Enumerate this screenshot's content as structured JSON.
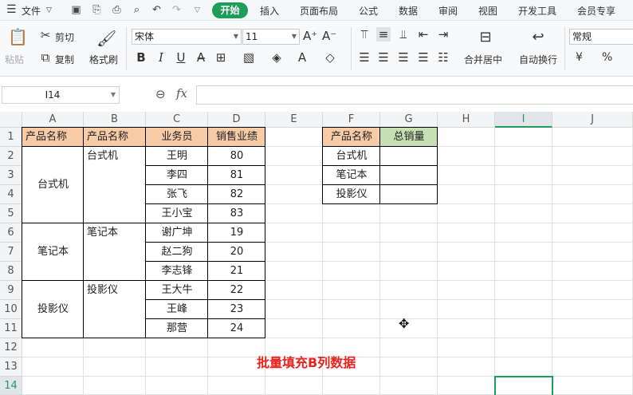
{
  "menubar": {
    "file": "文件",
    "tabs": [
      "开始",
      "插入",
      "页面布局",
      "公式",
      "数据",
      "审阅",
      "视图",
      "开发工具",
      "会员专享"
    ]
  },
  "ribbon": {
    "paste": "粘贴",
    "cut": "剪切",
    "copy": "复制",
    "format_painter": "格式刷",
    "font_name": "宋体",
    "font_size": "11",
    "merge_center": "合并居中",
    "wrap_text": "自动换行",
    "number_format": "常规",
    "currency": "¥",
    "percent": "%"
  },
  "formula_bar": {
    "name_box": "I14",
    "fx": "fx",
    "content": ""
  },
  "columns": [
    "A",
    "B",
    "C",
    "D",
    "E",
    "F",
    "G",
    "H",
    "I",
    "J"
  ],
  "rows": [
    "1",
    "2",
    "3",
    "4",
    "5",
    "6",
    "7",
    "8",
    "9",
    "10",
    "11",
    "12",
    "13",
    "14"
  ],
  "headers": {
    "a1": "产品名称",
    "b1": "产品名称",
    "c1": "业务员",
    "d1": "销售业绩",
    "f1": "产品名称",
    "g1": "总销量"
  },
  "groups": [
    {
      "name": "台式机",
      "b": "台式机",
      "rows": [
        [
          "王明",
          "80"
        ],
        [
          "李四",
          "81"
        ],
        [
          "张飞",
          "82"
        ],
        [
          "王小宝",
          "83"
        ]
      ]
    },
    {
      "name": "笔记本",
      "b": "笔记本",
      "rows": [
        [
          "谢广坤",
          "19"
        ],
        [
          "赵二狗",
          "20"
        ],
        [
          "李志锋",
          "21"
        ]
      ]
    },
    {
      "name": "投影仪",
      "b": "投影仪",
      "rows": [
        [
          "王大牛",
          "22"
        ],
        [
          "王峰",
          "23"
        ],
        [
          "那营",
          "24"
        ]
      ]
    }
  ],
  "summary": [
    {
      "product": "台式机",
      "total": ""
    },
    {
      "product": "笔记本",
      "total": ""
    },
    {
      "product": "投影仪",
      "total": ""
    }
  ],
  "annotation": "批量填充B列数据",
  "colors": {
    "header_orange": "#f8cba7",
    "header_green": "#c6e0b4",
    "accent": "#1e9d5a",
    "annotation": "#e8231c"
  }
}
